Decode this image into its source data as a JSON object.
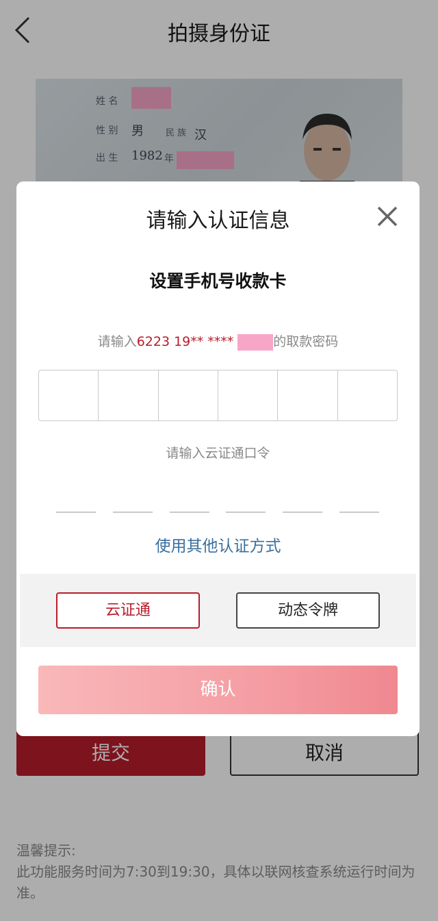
{
  "header": {
    "title": "拍摄身份证",
    "back_icon": "chevron-left-icon"
  },
  "id_card": {
    "name_label": "姓 名",
    "gender_label": "性 别",
    "gender_value": "男",
    "ethnicity_label": "民 族",
    "ethnicity_value": "汉",
    "birth_label": "出 生",
    "birth_year": "1982",
    "birth_year_unit": "年"
  },
  "actions": {
    "submit_label": "提交",
    "cancel_label": "取消"
  },
  "tips": {
    "title": "温馨提示:",
    "body": "此功能服务时间为7:30到19:30，具体以联网核查系统运行时间为准。"
  },
  "dialog": {
    "title": "请输入认证信息",
    "close_icon": "close-icon",
    "subtitle": "设置手机号收款卡",
    "pwd_prefix": "请输入",
    "pwd_card": "6223 19** ****",
    "pwd_suffix": "的取款密码",
    "pin_length": 6,
    "token_hint": "请输入云证通口令",
    "token_length": 6,
    "other_method": "使用其他认证方式",
    "method_yzt": "云证通",
    "method_token": "动态令牌",
    "confirm_label": "确认"
  },
  "colors": {
    "accent_red": "#b81c2a",
    "link_blue": "#3a6f9e",
    "confirm_gradient_start": "#f9b8b9",
    "confirm_gradient_end": "#f08890",
    "redaction_pink": "#f8a6c8"
  }
}
